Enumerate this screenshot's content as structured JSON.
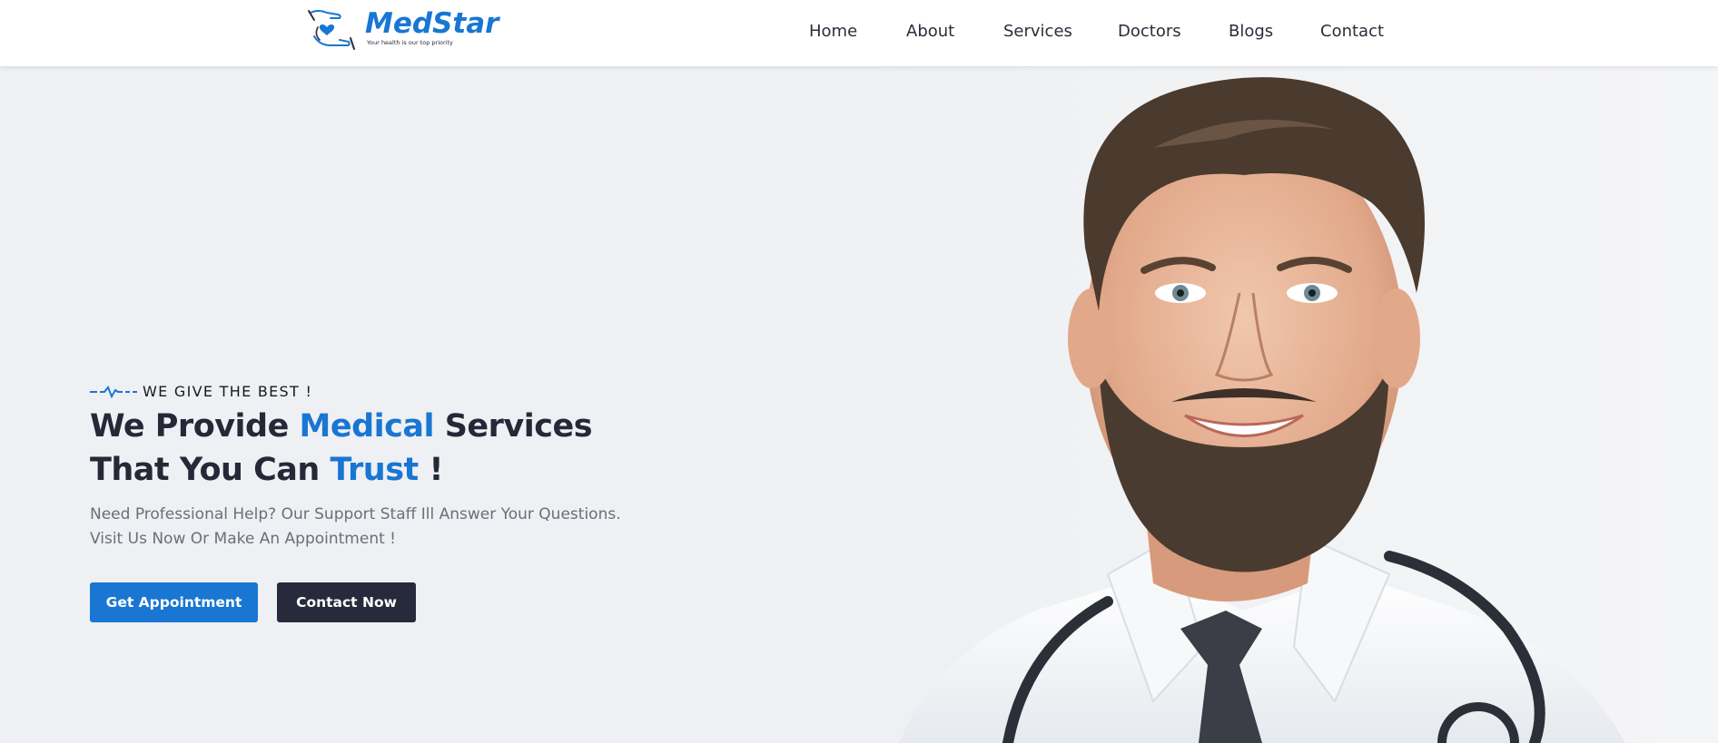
{
  "brand": {
    "name": "MedStar",
    "tagline": "Your health is our top priority",
    "color": "#1976d2"
  },
  "nav": {
    "items": [
      {
        "label": "Home"
      },
      {
        "label": "About"
      },
      {
        "label": "Services"
      },
      {
        "label": "Doctors"
      },
      {
        "label": "Blogs"
      },
      {
        "label": "Contact"
      }
    ]
  },
  "hero": {
    "eyebrow": "WE GIVE THE BEST !",
    "headline": {
      "part1": "We Provide ",
      "accent1": "Medical",
      "part2": " Services",
      "part3": "That You Can ",
      "accent2": "Trust",
      "part4": " !"
    },
    "description_line1": "Need Professional Help? Our Support Staff Ill Answer Your Questions.",
    "description_line2": "Visit Us Now Or Make An Appointment !",
    "primary_button": "Get Appointment",
    "secondary_button": "Contact Now"
  },
  "colors": {
    "accent": "#1976d2",
    "dark": "#272a3b",
    "background": "#eef0f3"
  }
}
